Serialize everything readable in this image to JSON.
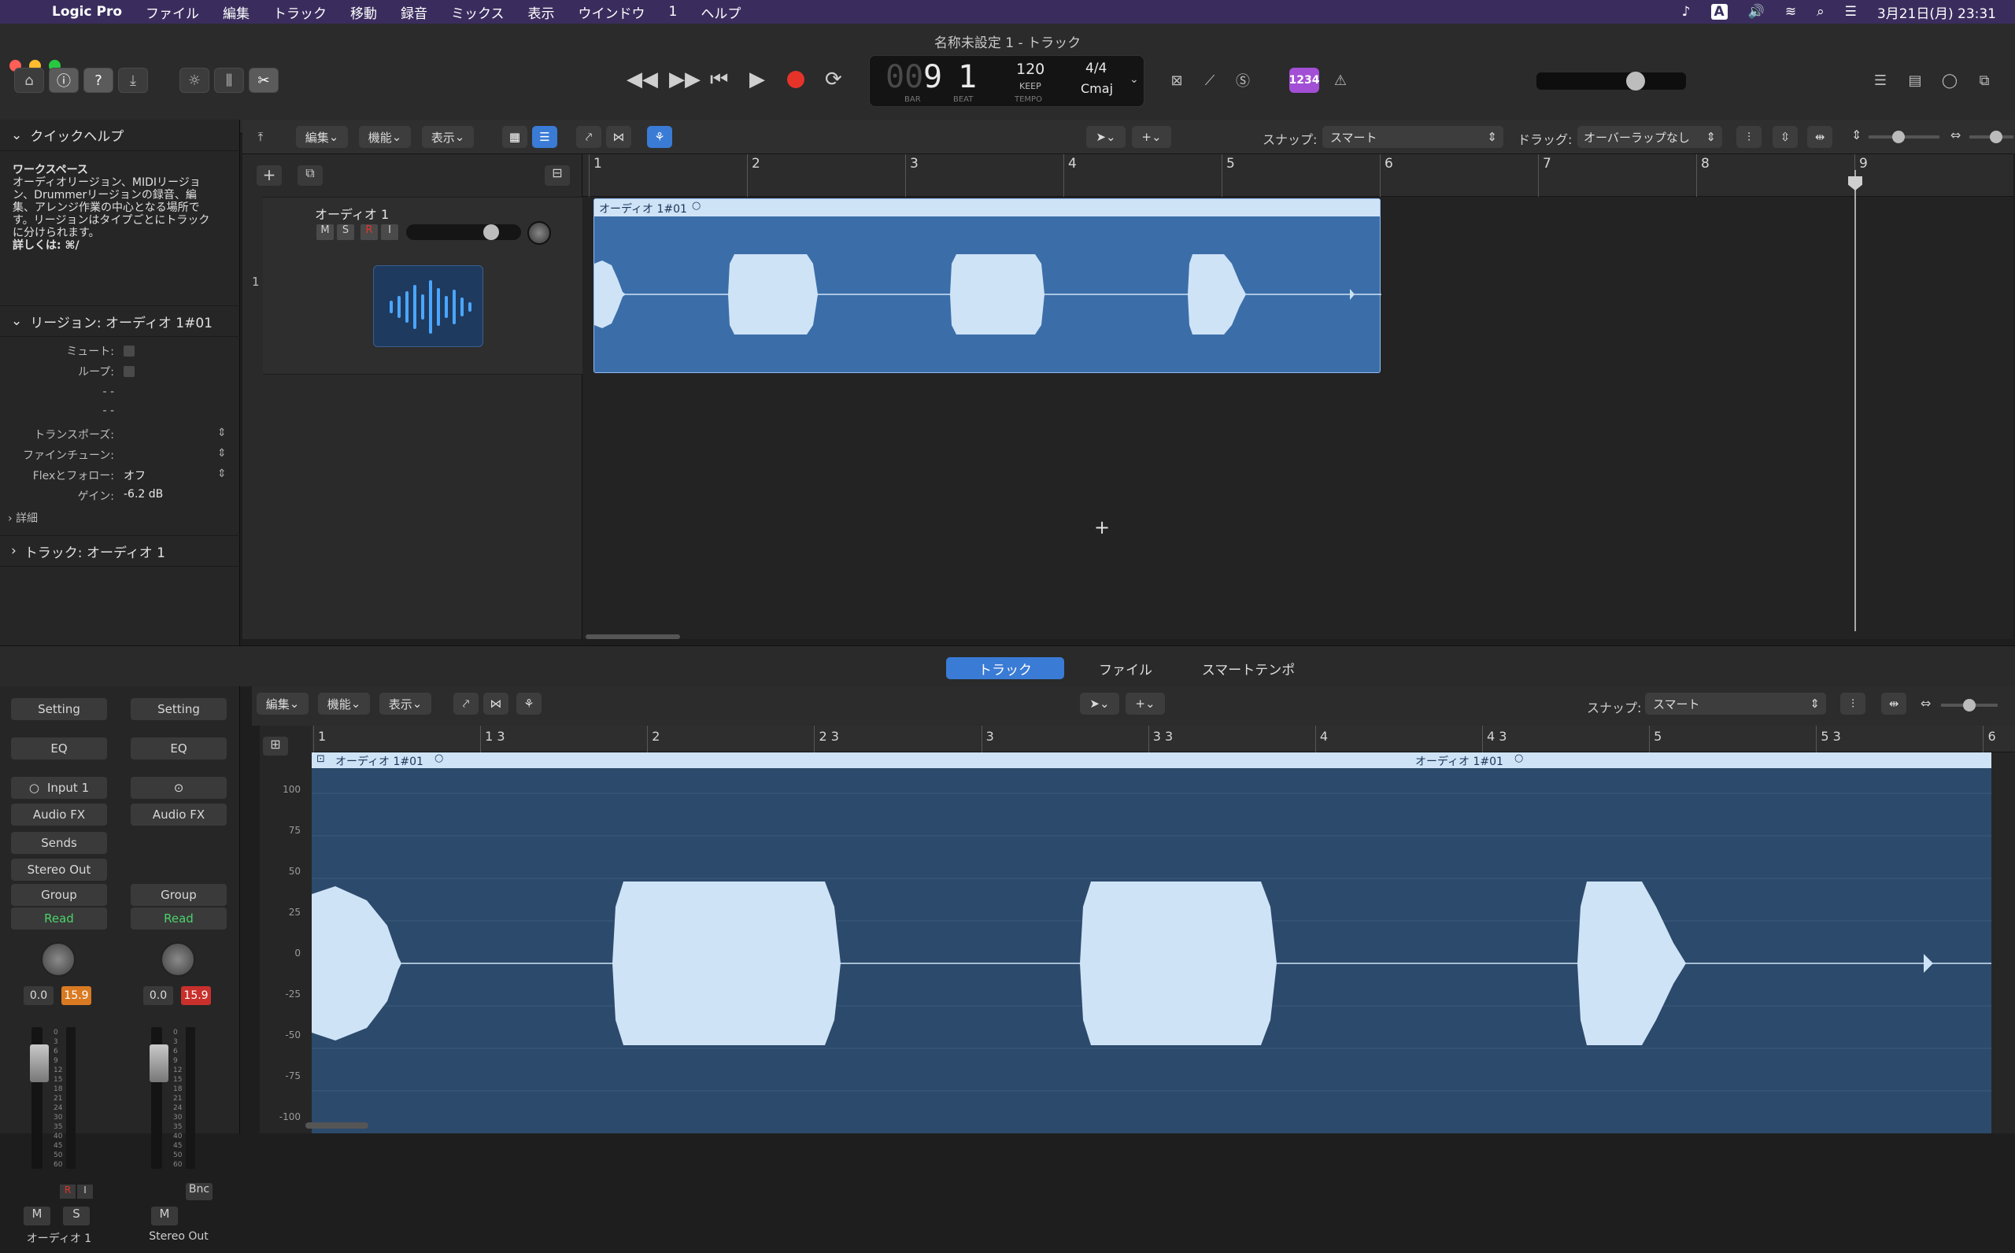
{
  "menubar": {
    "app": "Logic Pro",
    "items": [
      "ファイル",
      "編集",
      "トラック",
      "移動",
      "録音",
      "ミックス",
      "表示",
      "ウインドウ",
      "1",
      "ヘルプ"
    ],
    "clock": "3月21日(月)  23:31",
    "input_source": "A"
  },
  "window": {
    "title": "名称未設定 1 - トラック"
  },
  "lcd": {
    "bar_prefix": "00",
    "bar": "9",
    "beat": "1",
    "bar_label": "BAR",
    "beat_label": "BEAT",
    "tempo": "120",
    "tempo_mode": "KEEP",
    "tempo_label": "TEMPO",
    "time_sig": "4/4",
    "key": "Cmaj"
  },
  "toolbar": {
    "count_in": "1234"
  },
  "inspector": {
    "quick_help_title": "クイックヘルプ",
    "quick_help_heading": "ワークスペース",
    "quick_help_lines": [
      "オーディオリージョン、MIDIリージョ",
      "ン、Drummerリージョンの録音、編",
      "集、アレンジ作業の中心となる場所で",
      "す。リージョンはタイプごとにトラック",
      "に分けられます。"
    ],
    "quick_help_more": "詳しくは: ⌘/",
    "region_section": "リージョン: オーディオ 1#01",
    "props": [
      {
        "k": "ミュート:",
        "v": ""
      },
      {
        "k": "ループ:",
        "v": ""
      },
      {
        "k": "- -",
        "v": ""
      },
      {
        "k": "- -",
        "v": ""
      },
      {
        "k": "トランスポーズ:",
        "v": ""
      },
      {
        "k": "ファインチューン:",
        "v": ""
      },
      {
        "k": "Flexとフォロー:",
        "v": "オフ"
      },
      {
        "k": "ゲイン:",
        "v": "-6.2 dB"
      }
    ],
    "detail": "詳細",
    "track_section": "トラック: オーディオ 1"
  },
  "strips": [
    {
      "setting": "Setting",
      "eq": "EQ",
      "input": "Input 1",
      "fx": "Audio FX",
      "sends": "Sends",
      "out": "Stereo Out",
      "group": "Group",
      "auto": "Read",
      "vol": "0.0",
      "peak": "15.9",
      "name": "オーディオ 1",
      "m": "M",
      "s": "S",
      "r": "R",
      "i": "I"
    },
    {
      "setting": "Setting",
      "eq": "EQ",
      "input": "",
      "fx": "Audio FX",
      "sends": "",
      "out": "",
      "group": "Group",
      "auto": "Read",
      "vol": "0.0",
      "peak": "15.9",
      "name": "Stereo Out",
      "m": "M",
      "bnc": "Bnc"
    }
  ],
  "fader_scale": [
    "0",
    "3",
    "6",
    "9",
    "12",
    "15",
    "18",
    "21",
    "24",
    "30",
    "35",
    "40",
    "45",
    "50",
    "60"
  ],
  "tracks_toolbar": {
    "edit": "編集",
    "func": "機能",
    "view": "表示",
    "snap_label": "スナップ:",
    "snap_value": "スマート",
    "drag_label": "ドラッグ:",
    "drag_value": "オーバーラップなし"
  },
  "track": {
    "number": "1",
    "name": "オーディオ 1",
    "mute": "M",
    "solo": "S",
    "rec": "R",
    "input": "I"
  },
  "ruler_bars": [
    "1",
    "2",
    "3",
    "4",
    "5",
    "6",
    "7",
    "8",
    "9"
  ],
  "region": {
    "name": "オーディオ 1#01"
  },
  "editor_tabs": [
    "トラック",
    "ファイル",
    "スマートテンポ"
  ],
  "editor_toolbar": {
    "edit": "編集",
    "func": "機能",
    "view": "表示",
    "snap_label": "スナップ:",
    "snap_value": "スマート"
  },
  "editor_ruler": [
    "1",
    "1 3",
    "2",
    "2 3",
    "3",
    "3 3",
    "4",
    "4 3",
    "5",
    "5 3",
    "6"
  ],
  "editor_region_labels": [
    "オーディオ 1#01",
    "オーディオ 1#01"
  ],
  "amplitude_scale": [
    "100",
    "75",
    "50",
    "25",
    "0",
    "-25",
    "-50",
    "-75",
    "-100"
  ],
  "colors": {
    "menubar": "#3a2d5e",
    "region": "#3b6ea8",
    "wave": "#cfe3f7",
    "record": "#e5332a",
    "accent": "#3a7bd5"
  }
}
